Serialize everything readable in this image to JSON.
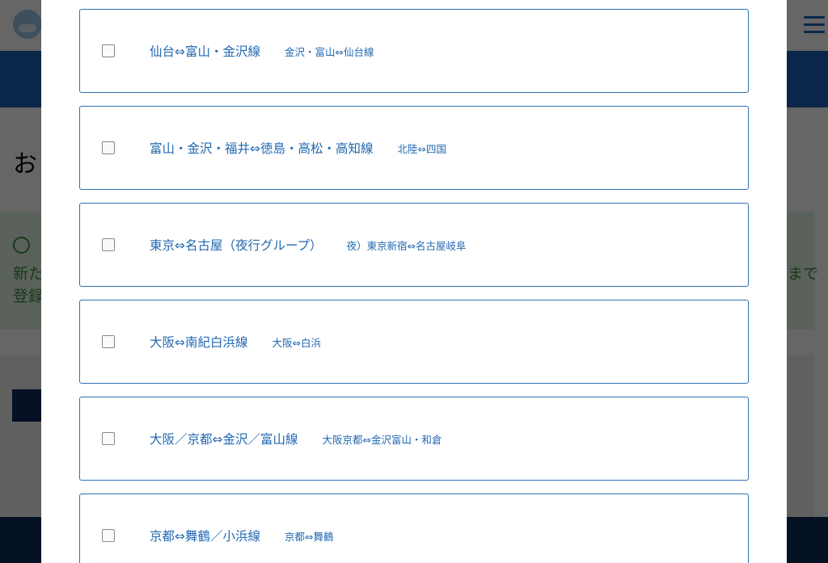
{
  "background": {
    "title_fragment": "お",
    "notice_lines": [
      "新た",
      "登録"
    ],
    "notice_right": "まで"
  },
  "routes": [
    {
      "name": "仙台⇔富山・金沢線",
      "sub": "金沢・富山⇔仙台線",
      "checked": false
    },
    {
      "name": "富山・金沢・福井⇔徳島・高松・高知線",
      "sub": "北陸⇔四国",
      "checked": false
    },
    {
      "name": "東京⇔名古屋（夜行グループ）",
      "sub": "夜）東京新宿⇔名古屋岐阜",
      "checked": false
    },
    {
      "name": "大阪⇔南紀白浜線",
      "sub": "大阪⇔白浜",
      "checked": false
    },
    {
      "name": "大阪／京都⇔金沢／富山線",
      "sub": "大阪京都⇔金沢富山・和倉",
      "checked": false
    },
    {
      "name": "京都⇔舞鶴／小浜線",
      "sub": "京都⇔舞鶴",
      "checked": false
    }
  ],
  "colors": {
    "card_border": "#2f6fb5",
    "link_text": "#2268b1",
    "nav_blue": "#1a5fb4",
    "overlay": "rgba(0,0,0,0.6)"
  }
}
